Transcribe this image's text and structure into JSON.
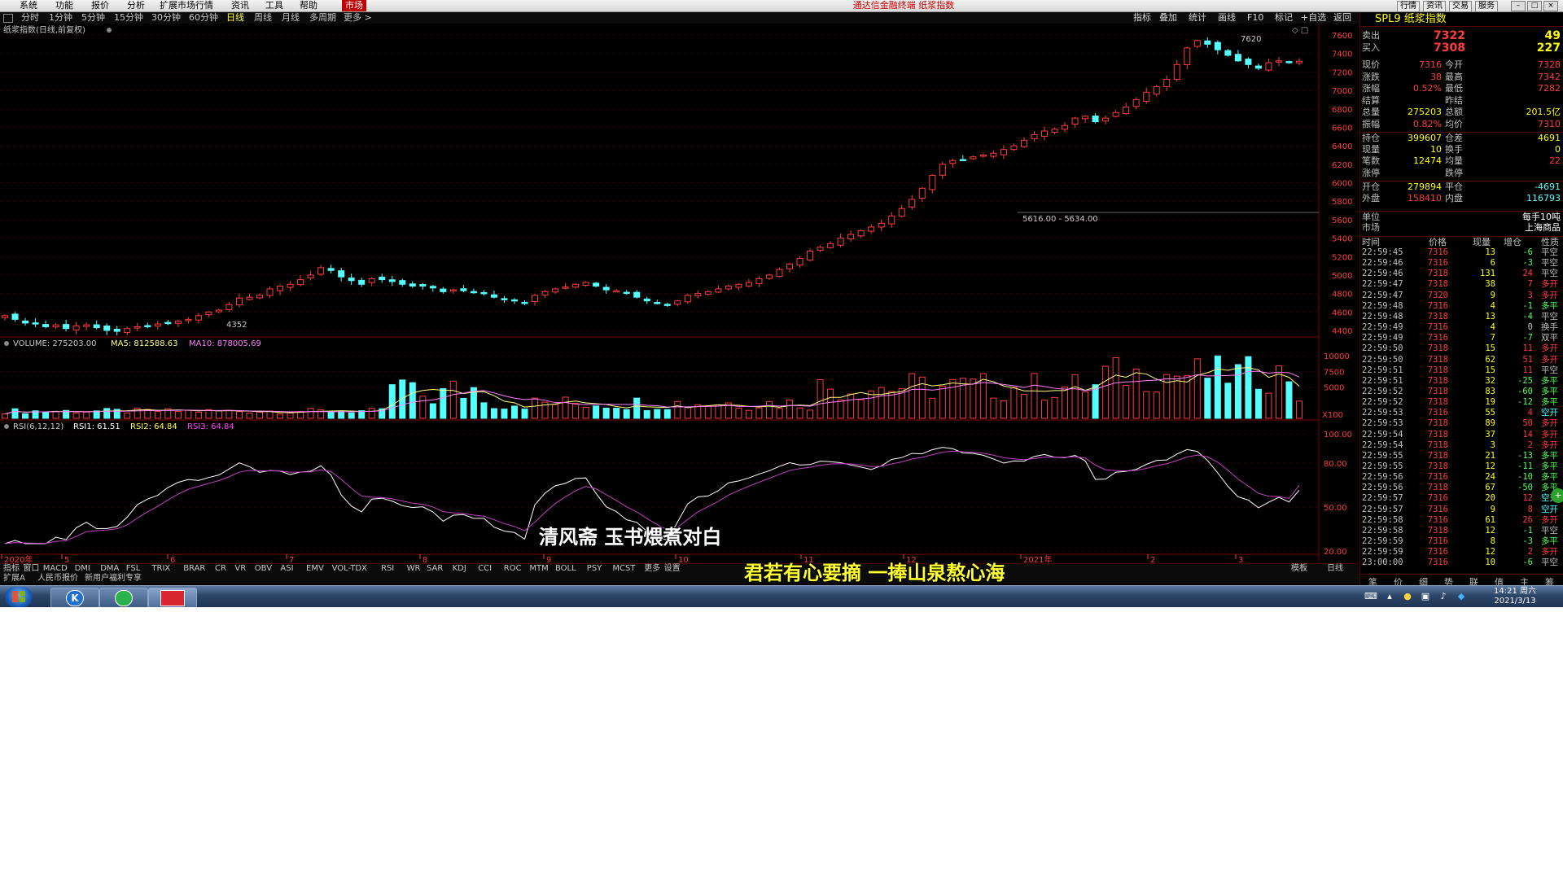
{
  "menubar": {
    "items": [
      "系统",
      "功能",
      "报价",
      "分析",
      "扩展市场行情",
      "资讯",
      "工具",
      "帮助",
      "市场"
    ],
    "title": "通达信金融终端  纸浆指数",
    "right_buttons": [
      "行情",
      "资讯",
      "交易",
      "服务"
    ]
  },
  "periodbar": {
    "items": [
      "分时",
      "1分钟",
      "5分钟",
      "15分钟",
      "30分钟",
      "60分钟",
      "日线",
      "周线",
      "月线",
      "多周期",
      "更多 >"
    ],
    "selected": "日线",
    "tools": [
      "指标",
      "叠加",
      "统计",
      "画线",
      "F10",
      "标记",
      "+自选",
      "返回"
    ]
  },
  "chart": {
    "name": "纸浆指数(日线,前复权)",
    "price_axis": [
      "7600",
      "7400",
      "7200",
      "7000",
      "6800",
      "6600",
      "6400",
      "6200",
      "6000",
      "5800",
      "5600",
      "5400",
      "5200",
      "5000",
      "4800",
      "4600",
      "4400"
    ],
    "high_label": "7620",
    "low_label": "4352",
    "range_label": "5616.00 - 5634.00",
    "volume_header": {
      "title": "VOLUME: 275203.00",
      "ma5": "MA5: 812588.63",
      "ma10": "MA10: 878005.69"
    },
    "volume_axis": [
      "10000",
      "7500",
      "5000"
    ],
    "volume_unit": "X100",
    "rsi_header": {
      "title": "RSI(6,12,12)",
      "rsi1": "RSI1: 61.51",
      "rsi2": "RSI2: 64.84",
      "rsi3": "RSI3: 64.84"
    },
    "rsi_axis": [
      "100.00",
      "80.00",
      "50.00",
      "20.00"
    ],
    "date_labels": [
      "2020年",
      "5",
      "6",
      "7",
      "8",
      "9",
      "10",
      "11",
      "12",
      "2021年",
      "2",
      "3"
    ]
  },
  "chart_data": [
    {
      "type": "candlestick",
      "title": "纸浆指数(日线,前复权)",
      "ylim": [
        4352,
        7620
      ],
      "close_approx": [
        4560,
        4520,
        4480,
        4470,
        4440,
        4460,
        4420,
        4450,
        4460,
        4430,
        4400,
        4390,
        4420,
        4440,
        4450,
        4470,
        4480,
        4500,
        4520,
        4560,
        4600,
        4620,
        4680,
        4750,
        4760,
        4780,
        4850,
        4880,
        4900,
        4950,
        5000,
        5080,
        5050,
        4980,
        4940,
        4900,
        4960,
        4950,
        4930,
        4900,
        4880,
        4880,
        4860,
        4820,
        4840,
        4830,
        4810,
        4800,
        4760,
        4740,
        4720,
        4700,
        4780,
        4820,
        4850,
        4870,
        4900,
        4920,
        4880,
        4840,
        4830,
        4800,
        4760,
        4720,
        4700,
        4680,
        4720,
        4780,
        4800,
        4820,
        4850,
        4880,
        4900,
        4920,
        4960,
        5000,
        5060,
        5120,
        5180,
        5260,
        5300,
        5340,
        5400,
        5440,
        5480,
        5520,
        5560,
        5640,
        5720,
        5820,
        5940,
        6080,
        6200,
        6240,
        6250,
        6280,
        6300,
        6320,
        6360,
        6400,
        6460,
        6520,
        6560,
        6580,
        6620,
        6700,
        6720,
        6660,
        6700,
        6760,
        6820,
        6900,
        6980,
        7040,
        7120,
        7280,
        7460,
        7540,
        7500,
        7440,
        7380,
        7320,
        7280,
        7240,
        7300,
        7320,
        7310,
        7316
      ],
      "last": 7316
    },
    {
      "type": "bar",
      "title": "VOLUME",
      "unit": "X100",
      "last": 275203.0,
      "ma5": 812588.63,
      "ma10": 878005.69,
      "ylim": [
        0,
        10000
      ]
    },
    {
      "type": "line",
      "title": "RSI(6,12,12)",
      "series": [
        {
          "name": "RSI1",
          "last": 61.51
        },
        {
          "name": "RSI2",
          "last": 64.84
        },
        {
          "name": "RSI3",
          "last": 64.84
        }
      ],
      "ylim": [
        20,
        100
      ]
    }
  ],
  "indicator_tabs": [
    "指标",
    "窗口",
    "MACD",
    "DMI",
    "DMA",
    "FSL",
    "TRIX",
    "BRAR",
    "CR",
    "VR",
    "OBV",
    "ASI",
    "EMV",
    "VOL-TDX",
    "RSI",
    "WR",
    "SAR",
    "KDJ",
    "CCI",
    "ROC",
    "MTM",
    "BOLL",
    "PSY",
    "MCST",
    "更多",
    "设置"
  ],
  "indicator_right": [
    "模板",
    "日线"
  ],
  "bottom_tabs": [
    "扩展A",
    "人民币报价",
    "新用户福利专享"
  ],
  "subtitles": {
    "line1": "清风斋  玉书煨煮对白",
    "line2": "君若有心要摘  一捧山泉熬心海"
  },
  "quote": {
    "title": "SPL9 纸浆指数",
    "sell": {
      "label": "卖出",
      "price": "7322",
      "vol": "49"
    },
    "buy": {
      "label": "买入",
      "price": "7308",
      "vol": "227"
    },
    "rows": [
      {
        "l1": "现价",
        "v1": "7316",
        "l2": "今开",
        "v2": "7328"
      },
      {
        "l1": "涨跌",
        "v1": "38",
        "l2": "最高",
        "v2": "7342"
      },
      {
        "l1": "涨幅",
        "v1": "0.52%",
        "l2": "最低",
        "v2": "7282"
      },
      {
        "l1": "结算",
        "v1": "",
        "l2": "昨结",
        "v2": ""
      },
      {
        "l1": "总量",
        "v1": "275203",
        "l2": "总额",
        "v2": "201.5亿"
      },
      {
        "l1": "振幅",
        "v1": "0.82%",
        "l2": "均价",
        "v2": "7310"
      },
      {
        "l1": "持仓",
        "v1": "399607",
        "l2": "仓差",
        "v2": "4691"
      },
      {
        "l1": "现量",
        "v1": "10",
        "l2": "换手",
        "v2": "0"
      },
      {
        "l1": "笔数",
        "v1": "12474",
        "l2": "均量",
        "v2": "22"
      },
      {
        "l1": "涨停",
        "v1": "",
        "l2": "跌停",
        "v2": ""
      },
      {
        "l1": "开仓",
        "v1": "279894",
        "l2": "平仓",
        "v2": "-4691"
      },
      {
        "l1": "外盘",
        "v1": "158410",
        "l2": "内盘",
        "v2": "116793"
      }
    ],
    "unit_label": "单位",
    "unit_value": "每手10吨",
    "market_label": "市场",
    "market_value": "上海商品"
  },
  "ticks": {
    "headers": [
      "时间",
      "价格",
      "现量",
      "增仓",
      "性质"
    ],
    "rows": [
      [
        "22:59:45",
        "7316",
        "13",
        "-6",
        "平空"
      ],
      [
        "22:59:46",
        "7316",
        "6",
        "-3",
        "平空"
      ],
      [
        "22:59:46",
        "7318",
        "131",
        "24",
        "平空"
      ],
      [
        "22:59:47",
        "7318",
        "38",
        "7",
        "多开"
      ],
      [
        "22:59:47",
        "7320",
        "9",
        "3",
        "多开"
      ],
      [
        "22:59:48",
        "7316",
        "4",
        "-1",
        "多平"
      ],
      [
        "22:59:48",
        "7318",
        "13",
        "-4",
        "平空"
      ],
      [
        "22:59:49",
        "7316",
        "4",
        "0",
        "换手"
      ],
      [
        "22:59:49",
        "7316",
        "7",
        "-7",
        "双平"
      ],
      [
        "22:59:50",
        "7318",
        "15",
        "11",
        "多开"
      ],
      [
        "22:59:50",
        "7318",
        "62",
        "51",
        "多开"
      ],
      [
        "22:59:51",
        "7318",
        "15",
        "11",
        "平空"
      ],
      [
        "22:59:51",
        "7318",
        "32",
        "-25",
        "多平"
      ],
      [
        "22:59:52",
        "7318",
        "83",
        "-60",
        "多平"
      ],
      [
        "22:59:52",
        "7318",
        "19",
        "-12",
        "多平"
      ],
      [
        "22:59:53",
        "7316",
        "55",
        "4",
        "空开"
      ],
      [
        "22:59:53",
        "7318",
        "89",
        "50",
        "多开"
      ],
      [
        "22:59:54",
        "7318",
        "37",
        "14",
        "多开"
      ],
      [
        "22:59:54",
        "7318",
        "3",
        "2",
        "多开"
      ],
      [
        "22:59:55",
        "7318",
        "21",
        "-13",
        "多平"
      ],
      [
        "22:59:55",
        "7318",
        "12",
        "-11",
        "多平"
      ],
      [
        "22:59:56",
        "7316",
        "24",
        "-10",
        "多平"
      ],
      [
        "22:59:56",
        "7318",
        "67",
        "-50",
        "多平"
      ],
      [
        "22:59:57",
        "7316",
        "20",
        "12",
        "空开"
      ],
      [
        "22:59:57",
        "7316",
        "9",
        "8",
        "空开"
      ],
      [
        "22:59:58",
        "7316",
        "61",
        "26",
        "多开"
      ],
      [
        "22:59:58",
        "7318",
        "12",
        "-1",
        "平空"
      ],
      [
        "22:59:59",
        "7316",
        "8",
        "-3",
        "多平"
      ],
      [
        "22:59:59",
        "7316",
        "12",
        "2",
        "多开"
      ],
      [
        "23:00:00",
        "7316",
        "10",
        "-6",
        "平空"
      ]
    ]
  },
  "panel_bottom_tabs": [
    "笔",
    "价",
    "细",
    "势",
    "联",
    "值",
    "主",
    "筹"
  ],
  "taskbar": {
    "time": "14:21 周六",
    "date": "2021/3/13"
  },
  "colors": {
    "up": "#ff3c3c",
    "down": "#54ffff",
    "axis": "#ff3c3c",
    "grid": "#550000",
    "price_yellow": "#ffff00",
    "subtitle1": "#ffffff",
    "subtitle2": "#ffff30"
  }
}
